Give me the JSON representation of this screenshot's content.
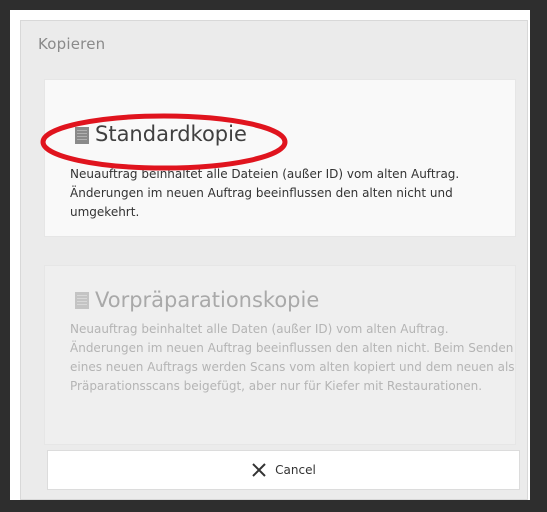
{
  "dialog": {
    "title": "Kopieren"
  },
  "options": [
    {
      "heading": "Standardkopie",
      "description": "Neuauftrag beinhaltet alle Dateien (außer ID) vom alten Auftrag. Änderungen im neuen Auftrag beeinflussen den alten nicht und umgekehrt.",
      "icon": "document-icon",
      "enabled": true
    },
    {
      "heading": "Vorpräparationskopie",
      "description": "Neuauftrag beinhaltet alle Daten (außer ID) vom alten Auftrag. Änderungen im neuen Auftrag beeinflussen den alten nicht. Beim Senden eines neuen Auftrags werden Scans vom alten kopiert und dem neuen als Präparationsscans beigefügt, aber nur für Kiefer mit Restaurationen.",
      "icon": "document-icon",
      "enabled": false
    }
  ],
  "cancel": {
    "label": "Cancel",
    "icon": "close-x-icon"
  },
  "annotation": {
    "color": "#e0141e",
    "shape": "ellipse-highlight"
  },
  "colors": {
    "backdrop": "#2e2e2e",
    "dialog_bg": "#ebebeb",
    "card_bg": "#f9f9f9",
    "disabled_text": "#b4b4b4"
  }
}
